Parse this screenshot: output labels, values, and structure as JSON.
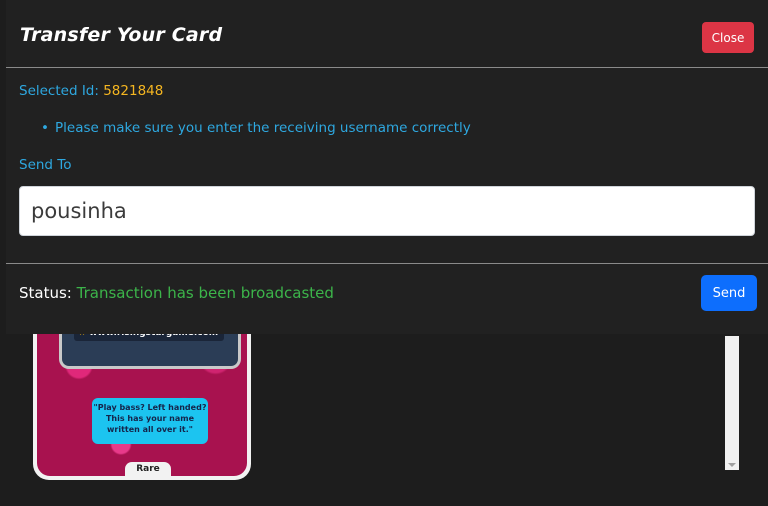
{
  "modal": {
    "title": "Transfer Your Card",
    "close_label": "Close",
    "selected_label": "Selected Id:",
    "selected_id": "5821848",
    "note": "Please make sure you enter the receiving username correctly",
    "send_to_label": "Send To",
    "recipient_value": "pousinha",
    "status_label": "Status:",
    "status_value": "Transaction has been broadcasted",
    "send_label": "Send"
  },
  "card": {
    "url": "www.risingstargame.com",
    "quote": "\"Play bass? Left handed? This has your name written all over it.\"",
    "rarity": "Rare"
  },
  "colors": {
    "accent_text": "#2ea8e0",
    "id_color": "#f5b621",
    "status_success": "#3cb44a",
    "close_button": "#dc3545",
    "send_button": "#0d6efd"
  }
}
